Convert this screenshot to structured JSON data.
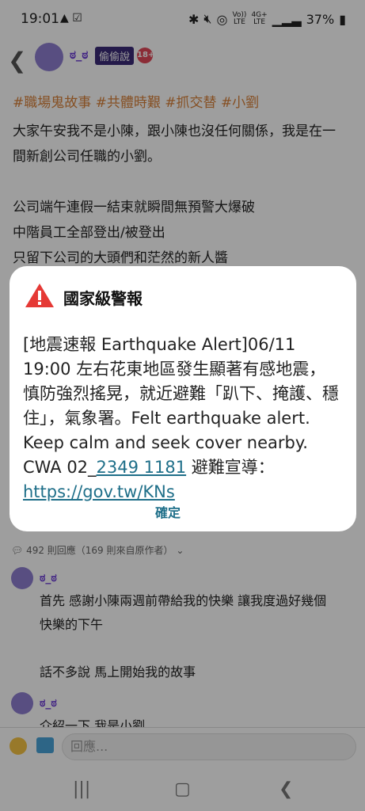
{
  "status_bar": {
    "time": "19:01",
    "battery": "37%",
    "network_top": "Vo))",
    "network_bottom": "LTE",
    "signal_top": "4G+",
    "signal_bottom": "LTE"
  },
  "header": {
    "author": "ಠ_ಠ",
    "tag": "偷偷說",
    "adult_badge": "18+"
  },
  "post": {
    "hashtags": "#職場鬼故事 #共體時艱 #抓交替 #小劉",
    "lines": [
      "大家午安我不是小陳，跟小陳也沒任何關係，我是在一",
      "間新創公司任職的小劉。",
      "",
      "公司端午連假一結束就瞬間無預警大爆破",
      "中階員工全部登出/被登出",
      "只留下公司的大頭們和茫然的新人醬"
    ]
  },
  "comments_meta": "492 則回應（169 則來自原作者）",
  "comments": [
    {
      "author": "ಠ_ಠ",
      "lines": [
        "首先 感謝小陳兩週前帶給我的快樂 讓我度過好幾個",
        "快樂的下午",
        "",
        "話不多說 馬上開始我的故事"
      ]
    },
    {
      "author": "ಠ_ಠ",
      "lines": [
        "介紹一下 我是小劉"
      ]
    }
  ],
  "reply_placeholder": "回應...",
  "alert": {
    "title": "國家級警報",
    "message_main": "[地震速報 Earthquake Alert]06/11 19:00 左右花東地區發生顯著有感地震，慎防強烈搖晃，就近避難「趴下、掩護、穩住」，氣象署。Felt earthquake alert. Keep calm and seek cover nearby. CWA 02_",
    "phone": "2349 1181",
    "guide": " 避難宣導：",
    "url": "https://gov.tw/KNs",
    "confirm": "確定"
  },
  "colors": {
    "accent_purple": "#6b3bd6",
    "hashtag_orange": "#d8823a",
    "link_teal": "#1f6f89",
    "warning_red": "#e53935"
  }
}
